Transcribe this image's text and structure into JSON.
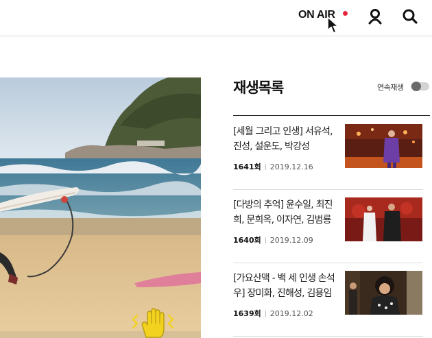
{
  "header": {
    "onair_label": "ON AIR",
    "icons": [
      "cursor-icon",
      "user-icon",
      "search-icon"
    ],
    "live_dot_color": "#e8243c"
  },
  "video": {
    "overlay_icon": "hand-icon",
    "overlay_color": "#f2d21f"
  },
  "playlist": {
    "title": "재생목록",
    "autoplay_label": "연속재생",
    "autoplay_on": false,
    "items": [
      {
        "title": "[세월 그리고 인생] 서유석, 진성, 설운도, 박강성",
        "episode": "1641회",
        "date": "2019.12.16"
      },
      {
        "title": "[다방의 추억] 윤수일, 최진희, 문희옥, 이자연, 김범룡",
        "episode": "1640회",
        "date": "2019.12.09"
      },
      {
        "title": "[가요산맥 - 백 세 인생 손석우] 장미화, 진해성, 김용임",
        "episode": "1639회",
        "date": "2019.12.02"
      }
    ]
  }
}
